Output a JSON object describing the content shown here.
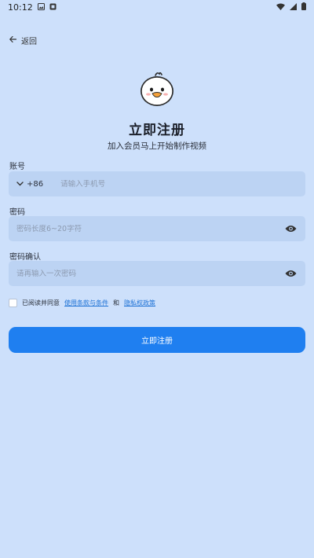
{
  "status_bar": {
    "time": "10:12"
  },
  "nav": {
    "back_label": "返回"
  },
  "header": {
    "title": "立即注册",
    "subtitle": "加入会员马上开始制作视频"
  },
  "form": {
    "account": {
      "label": "账号",
      "country_code": "+86",
      "placeholder": "请输入手机号"
    },
    "password": {
      "label": "密码",
      "placeholder": "密码长度6~20字符"
    },
    "password_confirm": {
      "label": "密码确认",
      "placeholder": "请再输入一次密码"
    },
    "agreement": {
      "prefix": "已阅读并同意",
      "terms_link": "使用条款与条件",
      "conjunction": "和",
      "privacy_link": "隐私权政策"
    },
    "submit_label": "立即注册"
  },
  "colors": {
    "background": "#cde0fb",
    "field": "#bcd3f3",
    "primary": "#1f7ff0",
    "link": "#1f73d6"
  }
}
